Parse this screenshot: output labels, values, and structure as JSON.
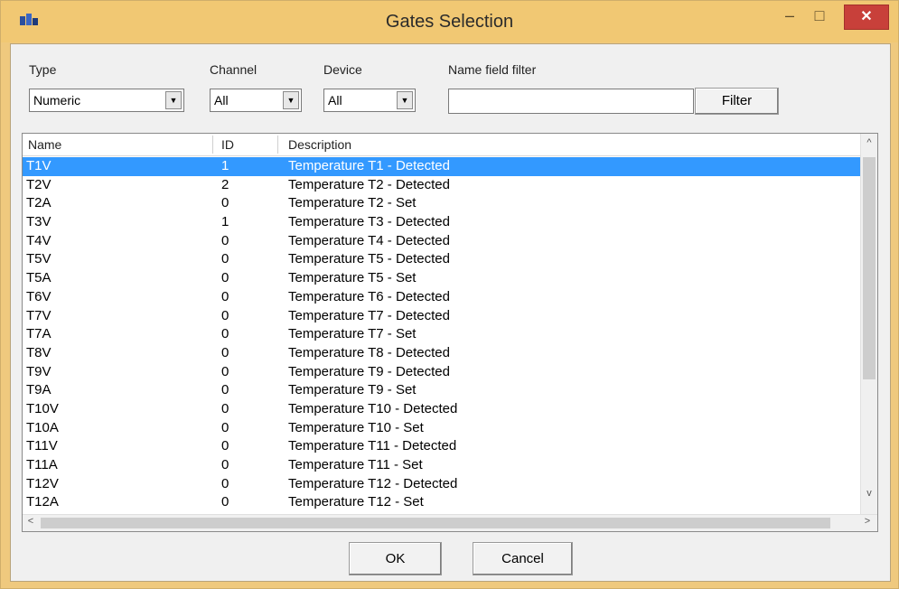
{
  "window": {
    "title": "Gates Selection",
    "controls": {
      "minimize": "–",
      "maximize": "□",
      "close": "✕"
    }
  },
  "filters": {
    "type_label": "Type",
    "type_value": "Numeric",
    "channel_label": "Channel",
    "channel_value": "All",
    "device_label": "Device",
    "device_value": "All",
    "name_filter_label": "Name field filter",
    "name_filter_value": "",
    "filter_button": "Filter"
  },
  "list": {
    "columns": [
      "Name",
      "ID",
      "Description"
    ],
    "rows": [
      {
        "name": "T1V",
        "id": "1",
        "desc": "Temperature T1 - Detected",
        "selected": true
      },
      {
        "name": "T2V",
        "id": "2",
        "desc": "Temperature T2 - Detected"
      },
      {
        "name": "T2A",
        "id": "0",
        "desc": "Temperature T2 - Set"
      },
      {
        "name": "T3V",
        "id": "1",
        "desc": "Temperature T3 - Detected"
      },
      {
        "name": "T4V",
        "id": "0",
        "desc": "Temperature T4 - Detected"
      },
      {
        "name": "T5V",
        "id": "0",
        "desc": "Temperature T5 - Detected"
      },
      {
        "name": "T5A",
        "id": "0",
        "desc": "Temperature T5 - Set"
      },
      {
        "name": "T6V",
        "id": "0",
        "desc": "Temperature T6 - Detected"
      },
      {
        "name": "T7V",
        "id": "0",
        "desc": "Temperature T7 - Detected"
      },
      {
        "name": "T7A",
        "id": "0",
        "desc": "Temperature T7 - Set"
      },
      {
        "name": "T8V",
        "id": "0",
        "desc": "Temperature T8 - Detected"
      },
      {
        "name": "T9V",
        "id": "0",
        "desc": "Temperature T9 - Detected"
      },
      {
        "name": "T9A",
        "id": "0",
        "desc": "Temperature T9 - Set"
      },
      {
        "name": "T10V",
        "id": "0",
        "desc": "Temperature T10 - Detected"
      },
      {
        "name": "T10A",
        "id": "0",
        "desc": "Temperature T10 - Set"
      },
      {
        "name": "T11V",
        "id": "0",
        "desc": "Temperature T11 - Detected"
      },
      {
        "name": "T11A",
        "id": "0",
        "desc": "Temperature T11 - Set"
      },
      {
        "name": "T12V",
        "id": "0",
        "desc": "Temperature T12 - Detected"
      },
      {
        "name": "T12A",
        "id": "0",
        "desc": "Temperature T12 - Set"
      }
    ]
  },
  "buttons": {
    "ok": "OK",
    "cancel": "Cancel"
  },
  "colors": {
    "selection": "#3399ff",
    "titlebar": "#f1c873",
    "close": "#c8403a"
  }
}
